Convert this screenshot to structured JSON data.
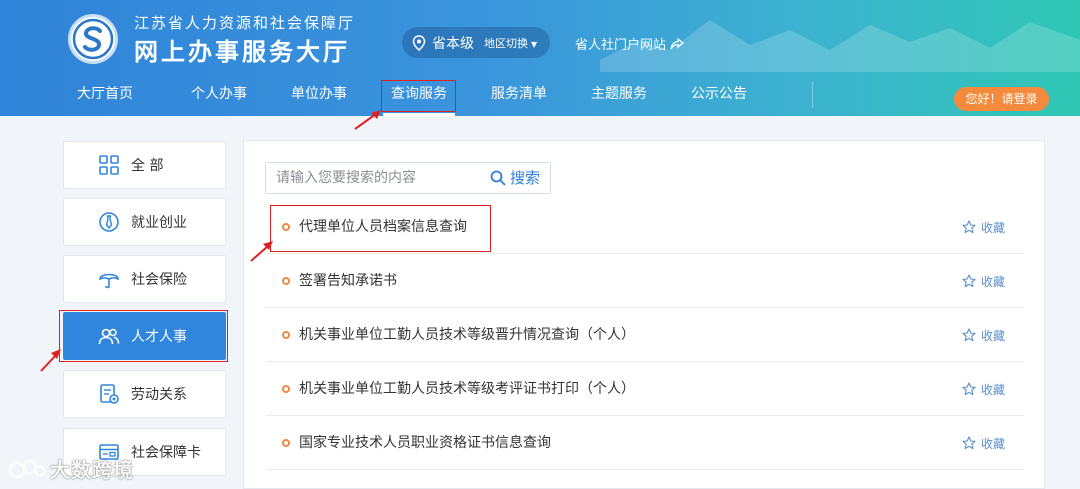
{
  "header": {
    "org_name": "江苏省人力资源和社会保障厅",
    "site_name": "网上办事服务大厅",
    "region": "省本级",
    "region_switch": "地区切换",
    "portal_link": "省人社门户网站"
  },
  "nav": {
    "items": [
      "大厅首页",
      "个人办事",
      "单位办事",
      "查询服务",
      "服务清单",
      "主题服务",
      "公示公告"
    ],
    "active": "查询服务",
    "login": "您好！请登录"
  },
  "sidebar": {
    "items": [
      {
        "label": "全 部",
        "icon": "grid-icon"
      },
      {
        "label": "就业创业",
        "icon": "tie-icon"
      },
      {
        "label": "社会保险",
        "icon": "umbrella-icon"
      },
      {
        "label": "人才人事",
        "icon": "users-icon"
      },
      {
        "label": "劳动关系",
        "icon": "document-icon"
      },
      {
        "label": "社会保障卡",
        "icon": "card-icon"
      }
    ],
    "active": "人才人事"
  },
  "search": {
    "placeholder": "请输入您要搜索的内容",
    "button": "搜索"
  },
  "results": {
    "favorite_label": "收藏",
    "items": [
      "代理单位人员档案信息查询",
      "签署告知承诺书",
      "机关事业单位工勤人员技术等级晋升情况查询（个人）",
      "机关事业单位工勤人员技术等级考评证书打印（个人）",
      "国家专业技术人员职业资格证书信息查询"
    ]
  },
  "watermark": "大数跨境",
  "colors": {
    "primary": "#2f86dc",
    "accent": "#f58a3c",
    "highlight": "#e02020"
  }
}
